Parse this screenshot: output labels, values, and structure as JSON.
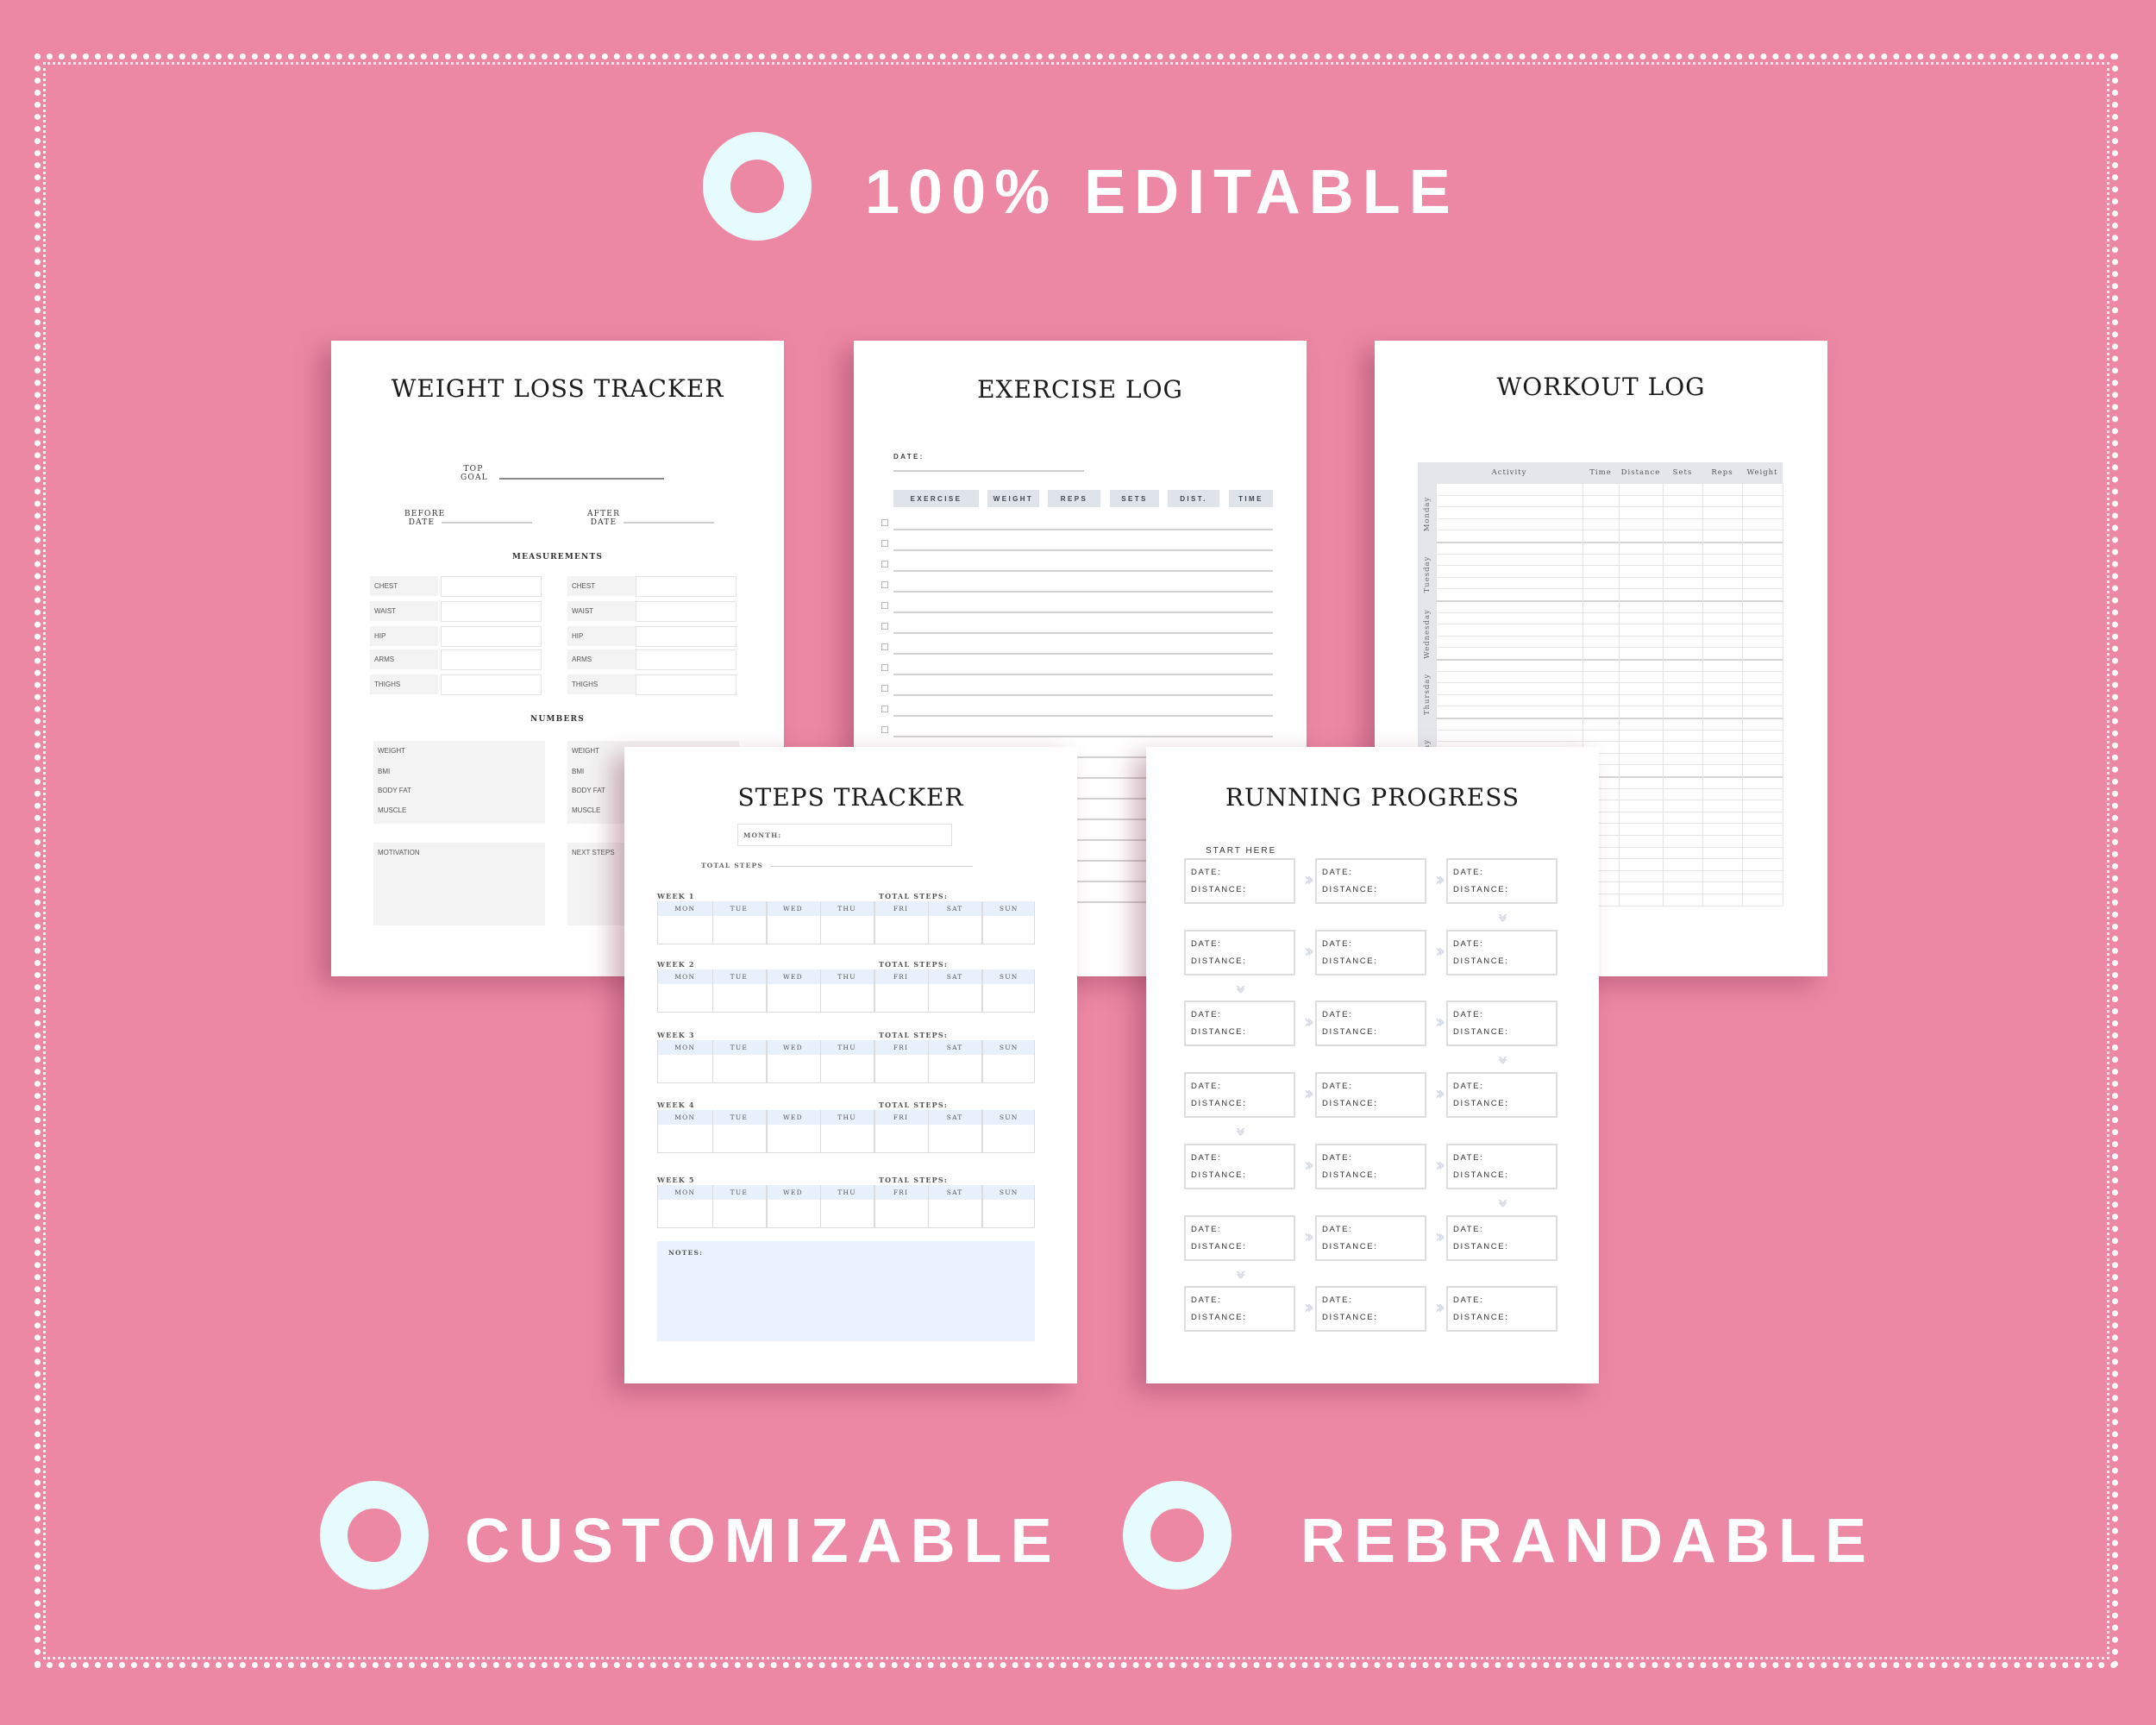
{
  "banner": {
    "top_feature": "100% EDITABLE",
    "bottom_features": [
      "CUSTOMIZABLE",
      "REBRANDABLE"
    ],
    "colors": {
      "background": "#EC88A4",
      "ring": "#E6FCFC",
      "text": "#FFFFFF"
    },
    "icons": {
      "feature_bullet": "ring-icon"
    }
  },
  "weight_loss_tracker": {
    "title": "WEIGHT LOSS TRACKER",
    "top_goal": [
      "TOP",
      "GOAL"
    ],
    "before_date": [
      "BEFORE",
      "DATE"
    ],
    "after_date": [
      "AFTER",
      "DATE"
    ],
    "measurements_heading": "MEASUREMENTS",
    "measurements": [
      "CHEST",
      "WAIST",
      "HIP",
      "ARMS",
      "THIGHS"
    ],
    "numbers_heading": "NUMBERS",
    "numbers": [
      "WEIGHT",
      "BMI",
      "BODY FAT",
      "MUSCLE"
    ],
    "motivation": "MOTIVATION",
    "next_steps": "NEXT STEPS"
  },
  "exercise_log": {
    "title": "EXERCISE LOG",
    "date_label": "DATE:",
    "columns": [
      "EXERCISE",
      "WEIGHT",
      "REPS",
      "SETS",
      "DIST.",
      "TIME"
    ],
    "header_color": "#DFE4EB"
  },
  "workout_log": {
    "title": "WORKOUT LOG",
    "columns": [
      "Activity",
      "Time",
      "Distance",
      "Sets",
      "Reps",
      "Weight"
    ],
    "days": [
      "Monday",
      "Tuesday",
      "Wednesday",
      "Thursday",
      "Friday"
    ],
    "header_color": "#E3E7EC"
  },
  "steps_tracker": {
    "title": "STEPS TRACKER",
    "month_label": "MONTH:",
    "total_steps_label": "TOTAL STEPS",
    "week_total_label": "TOTAL STEPS:",
    "weeks": [
      "WEEK 1",
      "WEEK 2",
      "WEEK 3",
      "WEEK 4",
      "WEEK 5"
    ],
    "days": [
      "MON",
      "TUE",
      "WED",
      "THU",
      "FRI",
      "SAT",
      "SUN"
    ],
    "notes_label": "NOTES:",
    "header_color": "#E8F1FB"
  },
  "running_progress": {
    "title": "RUNNING PROGRESS",
    "start_label": "START HERE",
    "date_label": "DATE:",
    "distance_label": "DISTANCE:",
    "rows": 7,
    "cols": 3,
    "arrow_color": "#D7DEE7"
  }
}
